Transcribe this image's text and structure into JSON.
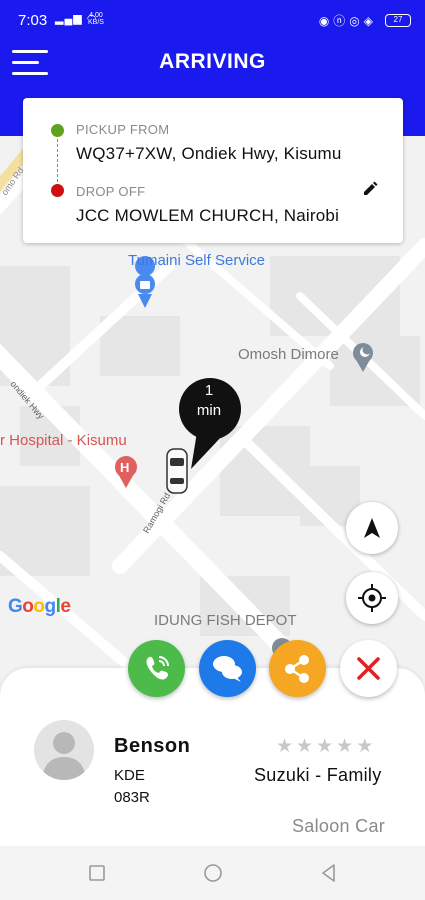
{
  "status_bar": {
    "time": "7:03",
    "net_speed_value": "4.00",
    "net_speed_unit": "KB/S",
    "battery": "27"
  },
  "header": {
    "title": "ARRIVING",
    "bg_color": "#1a1aee"
  },
  "route": {
    "pickup_label": "PICKUP FROM",
    "pickup_address": "WQ37+7XW, Ondiek Hwy, Kisumu",
    "dropoff_label": "DROP OFF",
    "dropoff_address": "JCC MOWLEM CHURCH, Nairobi",
    "pickup_color": "#5fa31a",
    "dropoff_color": "#d01010"
  },
  "map": {
    "pois": [
      {
        "name": "Tumaini Self Service",
        "icon": "shopping-bag-icon"
      },
      {
        "name": "Omosh Dimore",
        "icon": "moon-pin-icon"
      },
      {
        "name": "r Hospital - Kisumu",
        "icon": "hospital-icon"
      },
      {
        "name": "IDUNG FISH DEPOT",
        "icon": "pin-icon"
      }
    ],
    "roads": [
      "ondiek Hwy",
      "Ramogi Rd",
      "omo Rd"
    ],
    "attribution": "Google",
    "eta_value": "1",
    "eta_unit": "min"
  },
  "map_buttons": {
    "navigate": "navigation-arrow-icon",
    "locate": "my-location-icon"
  },
  "actions": {
    "call": {
      "icon": "phone-icon",
      "color": "#4dbb4a"
    },
    "chat": {
      "icon": "chat-icon",
      "color": "#1e7ae8"
    },
    "share": {
      "icon": "share-icon",
      "color": "#f5a623"
    },
    "cancel": {
      "icon": "close-icon",
      "color": "#e12020"
    }
  },
  "driver": {
    "name": "Benson",
    "plate": "KDE 083R",
    "rating_stars": 0,
    "rating_max": 5,
    "car_model": "Suzuki - Family",
    "car_class": "Saloon Car"
  },
  "navbar": {
    "items": [
      "recent-apps-icon",
      "home-icon",
      "back-icon"
    ]
  }
}
